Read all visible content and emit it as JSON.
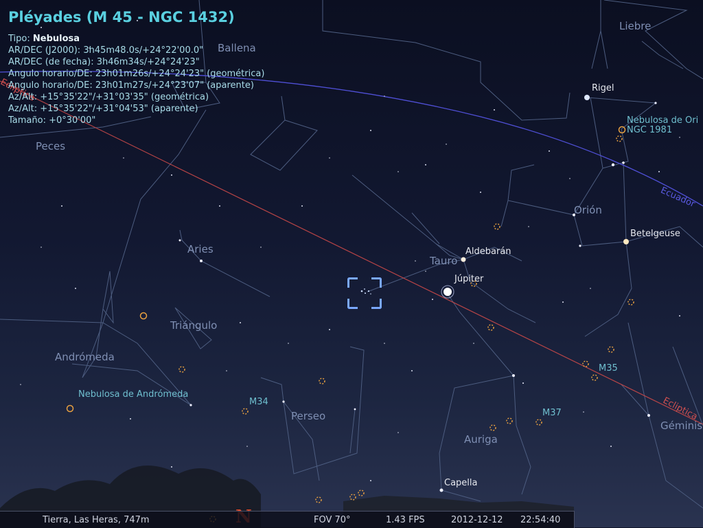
{
  "info_panel": {
    "title": "Pléyades (M 45 - NGC 1432)",
    "type_label": "Tipo:",
    "type_value": "Nebulosa",
    "rows": [
      "AR/DEC (J2000): 3h45m48.0s/+24°22'00.0\"",
      "AR/DEC (de fecha): 3h46m34s/+24°24'23\"",
      "Angulo horario/DE: 23h01m26s/+24°24'23\" (geométrica)",
      "Angulo horario/DE: 23h01m27s/+24°23'07\" (aparente)",
      "Az/Alt: +15°35'22\"/+31°03'35\" (geométrica)",
      "Az/Alt: +15°35'22\"/+31°04'53\" (aparente)",
      "Tamaño: +0°30'00\""
    ]
  },
  "constellations": {
    "ballena": "Ballena",
    "liebre": "Liebre",
    "peces": "Peces",
    "orion": "Orión",
    "tauro": "Tauro",
    "aries": "Aries",
    "triangulo": "Triángulo",
    "andromeda": "Andrómeda",
    "perseo": "Perseo",
    "auriga": "Auriga",
    "geminis": "Géminis"
  },
  "stars": {
    "rigel": "Rigel",
    "betelgeuse": "Betelgeuse",
    "aldebaran": "Aldebarán",
    "jupiter": "Júpiter",
    "capella": "Capella"
  },
  "deep_sky": {
    "orion_nebula_1": "Nebulosa de Ori",
    "orion_nebula_2": "NGC 1981",
    "m35": "M35",
    "m37": "M37",
    "m34": "M34",
    "andromeda_nebula": "Nebulosa de Andrómeda"
  },
  "lines": {
    "ecuador": "Ecuador",
    "ecliptica": "Ecliptica",
    "ecliptica_left": "Ecliptica"
  },
  "horizon": {
    "north": "N"
  },
  "status_bar": {
    "location": "Tierra, Las Heras, 747m",
    "fov": "FOV 70°",
    "fps": "1.43 FPS",
    "date": "2012-12-12",
    "time": "22:54:40"
  },
  "colors": {
    "info_title": "#5ad0e0",
    "constellation_label": "#7f8fb3",
    "ecliptic": "#c84848",
    "equator": "#5050d8",
    "selection": "#7aa8ff",
    "dso_marker": "#e8a040",
    "north": "#e04a2a"
  }
}
